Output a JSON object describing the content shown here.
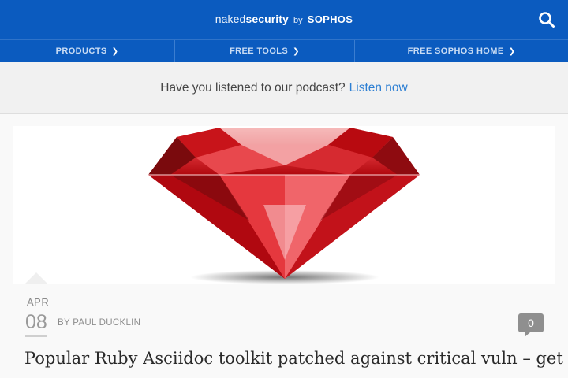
{
  "header": {
    "logo_light": "naked",
    "logo_bold": "security",
    "logo_by": "by",
    "logo_brand": "SOPHOS"
  },
  "nav": {
    "items": [
      {
        "label": "PRODUCTS"
      },
      {
        "label": "FREE TOOLS"
      },
      {
        "label": "FREE SOPHOS HOME"
      }
    ]
  },
  "banner": {
    "text": "Have you listened to our podcast?",
    "link": "Listen now"
  },
  "article": {
    "month": "APR",
    "day": "08",
    "byline": "BY PAUL DUCKLIN",
    "comment_count": "0",
    "title": "Popular Ruby Asciidoc toolkit patched against critical vuln – get the"
  },
  "colors": {
    "brand_blue": "#0b5bbf",
    "link_blue": "#2d7fd3",
    "ruby_red": "#d8141c"
  }
}
